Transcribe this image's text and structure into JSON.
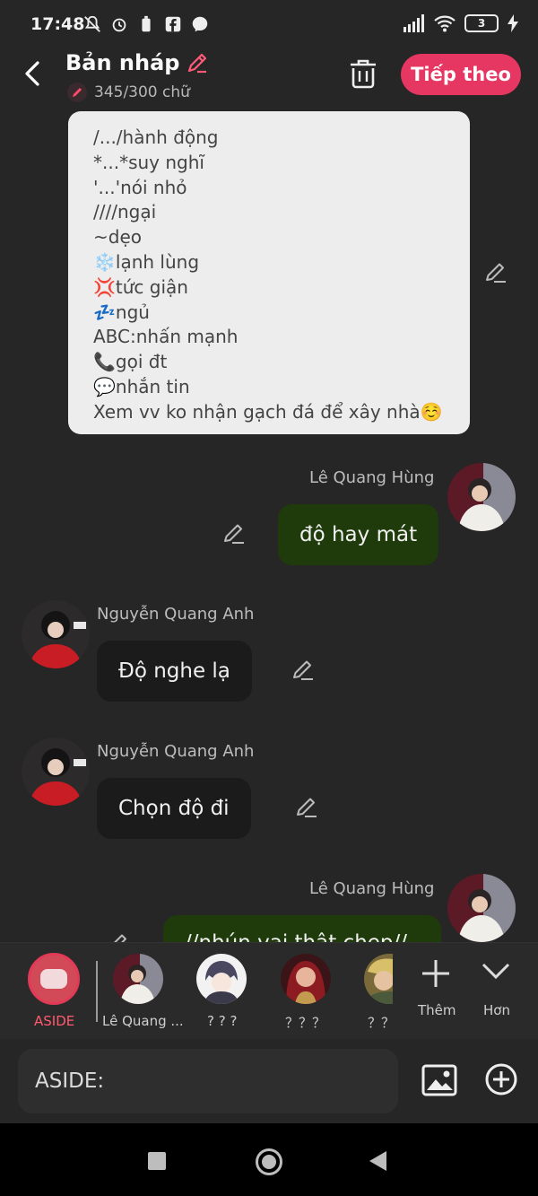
{
  "status_bar": {
    "time": "17:48",
    "battery": "3"
  },
  "header": {
    "title": "Bản nháp",
    "word_count": "345/300 chữ",
    "next_label": "Tiếp theo"
  },
  "note": {
    "lines": [
      "/.../hành động",
      "*...*suy nghĩ",
      "'...'nói nhỏ",
      "////ngại",
      "~dẹo",
      "❄️lạnh lùng",
      "💢tức giận",
      "💤ngủ",
      "ABC:nhấn mạnh",
      "📞gọi đt",
      "💬nhắn tin",
      "Xem vv ko nhận gạch đá để xây nhà☺️"
    ]
  },
  "messages": [
    {
      "sender": "Lê Quang Hùng",
      "text": "độ hay mát"
    },
    {
      "sender": "Nguyễn Quang Anh",
      "text": "Độ nghe lạ"
    },
    {
      "sender": "Nguyễn Quang Anh",
      "text": "Chọn độ đi"
    },
    {
      "sender": "Lê Quang Hùng",
      "text": "//nhún vai thật chẹp//"
    }
  ],
  "characters": {
    "aside_label": "ASIDE",
    "items": [
      {
        "label": "Lê Quang ..."
      },
      {
        "label": "? ? ?"
      },
      {
        "label": "？？？"
      },
      {
        "label": "？？"
      }
    ],
    "more_label": "Thêm",
    "expand_label": "Hơn"
  },
  "input": {
    "prefix": "ASIDE:"
  },
  "colors": {
    "accent": "#e63662",
    "my_bubble": "#1f3b0b",
    "their_bubble": "#1b1b1b",
    "note_bg": "#ededed"
  }
}
